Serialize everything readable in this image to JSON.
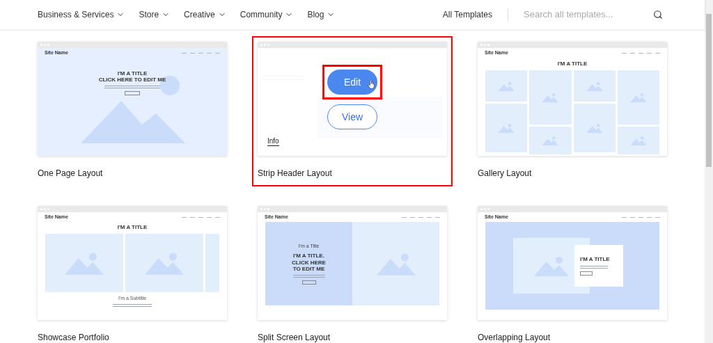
{
  "nav": {
    "categories": [
      {
        "label": "Business & Services"
      },
      {
        "label": "Store"
      },
      {
        "label": "Creative"
      },
      {
        "label": "Community"
      },
      {
        "label": "Blog"
      }
    ],
    "all_templates": "All Templates",
    "search": {
      "placeholder": "Search all templates..."
    }
  },
  "templates": [
    {
      "name": "One Page Layout",
      "kind": "hero",
      "site_name": "Site Name",
      "title_lines": [
        "I'M A TITLE",
        "CLICK HERE TO EDIT ME"
      ],
      "highlighted": false
    },
    {
      "name": "Strip Header Layout",
      "kind": "strip",
      "highlighted": true,
      "actions": {
        "edit": "Edit",
        "edit_highlighted": true,
        "view": "View",
        "info": "Info"
      }
    },
    {
      "name": "Gallery Layout",
      "kind": "gallery",
      "site_name": "Site Name",
      "title_lines": [
        "I'M A TITLE"
      ],
      "highlighted": false
    },
    {
      "name": "Showcase Portfolio",
      "kind": "showcase",
      "site_name": "Site Name",
      "title_lines": [
        "I'M A TITLE"
      ],
      "subtitle": "I'm a Subtitle",
      "highlighted": false
    },
    {
      "name": "Split Screen Layout",
      "kind": "split",
      "site_name": "Site Name",
      "eyebrow": "I'm a Title",
      "title_lines": [
        "I'M A TITLE.",
        "CLICK HERE",
        "TO EDIT ME"
      ],
      "highlighted": false
    },
    {
      "name": "Overlapping Layout",
      "kind": "overlap",
      "site_name": "Site Name",
      "title_lines": [
        "I'M A TITLE"
      ],
      "highlighted": false
    }
  ]
}
